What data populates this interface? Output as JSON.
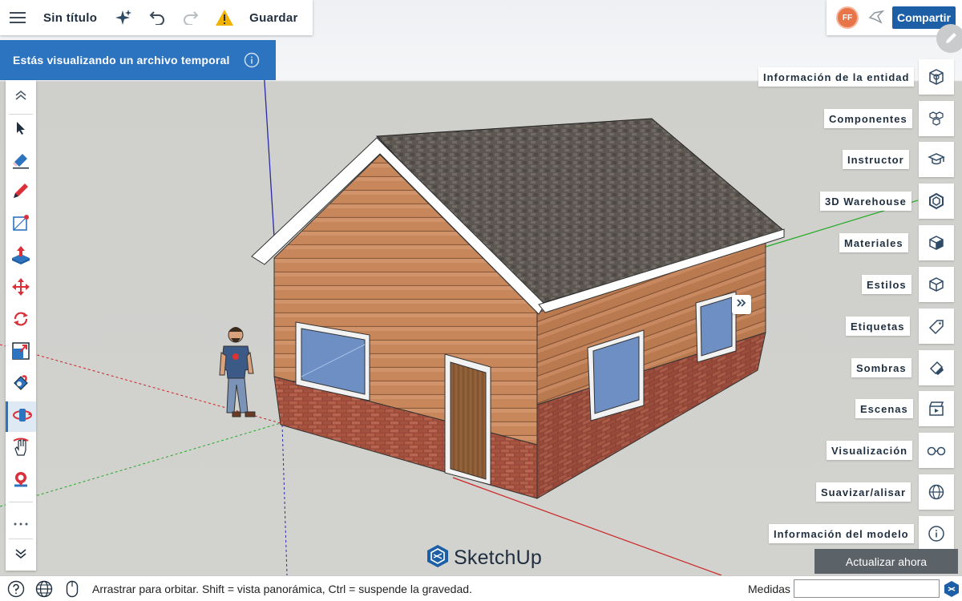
{
  "app": {
    "title": "Sin título",
    "save_label": "Guardar",
    "share_label": "Compartir",
    "avatar_initials": "FF",
    "accent_color": "#2c73c0",
    "share_color": "#1d5fa6",
    "warning_color": "#f2b300"
  },
  "banner": {
    "text": "Estás visualizando un archivo temporal"
  },
  "toolbar": {
    "tools": [
      {
        "name": "collapse-up",
        "icon": "chevron-up-icon"
      },
      {
        "name": "select",
        "icon": "arrow-cursor-icon"
      },
      {
        "name": "eraser",
        "icon": "eraser-icon"
      },
      {
        "name": "pencil",
        "icon": "pencil-icon"
      },
      {
        "name": "rectangle",
        "icon": "rectangle-icon"
      },
      {
        "name": "push-pull",
        "icon": "push-pull-icon"
      },
      {
        "name": "move",
        "icon": "move-icon"
      },
      {
        "name": "rotate",
        "icon": "rotate-icon"
      },
      {
        "name": "scale",
        "icon": "scale-icon"
      },
      {
        "name": "paint-bucket",
        "icon": "paint-bucket-icon"
      },
      {
        "name": "orbit",
        "icon": "orbit-icon",
        "active": true
      },
      {
        "name": "pan",
        "icon": "pan-icon"
      },
      {
        "name": "zoom",
        "icon": "zoom-icon"
      },
      {
        "name": "more",
        "icon": "more-icon"
      },
      {
        "name": "collapse-down",
        "icon": "chevron-down-icon"
      }
    ]
  },
  "panels": [
    {
      "label": "Información de la entidad",
      "icon": "entity-info-icon"
    },
    {
      "label": "Componentes",
      "icon": "components-icon"
    },
    {
      "label": "Instructor",
      "icon": "instructor-icon"
    },
    {
      "label": "3D Warehouse",
      "icon": "warehouse-icon"
    },
    {
      "label": "Materiales",
      "icon": "materials-icon"
    },
    {
      "label": "Estilos",
      "icon": "styles-icon"
    },
    {
      "label": "Etiquetas",
      "icon": "tags-icon"
    },
    {
      "label": "Sombras",
      "icon": "shadows-icon"
    },
    {
      "label": "Escenas",
      "icon": "scenes-icon"
    },
    {
      "label": "Visualización",
      "icon": "display-icon"
    },
    {
      "label": "Suavizar/alisar",
      "icon": "soften-icon"
    },
    {
      "label": "Información del modelo",
      "icon": "model-info-icon"
    }
  ],
  "update_button": "Actualizar ahora",
  "logo_text": "SketchUp",
  "statusbar": {
    "text": "Arrastrar para orbitar. Shift = vista panorámica, Ctrl = suspende la gravedad.",
    "measures_label": "Medidas",
    "measures_value": ""
  }
}
